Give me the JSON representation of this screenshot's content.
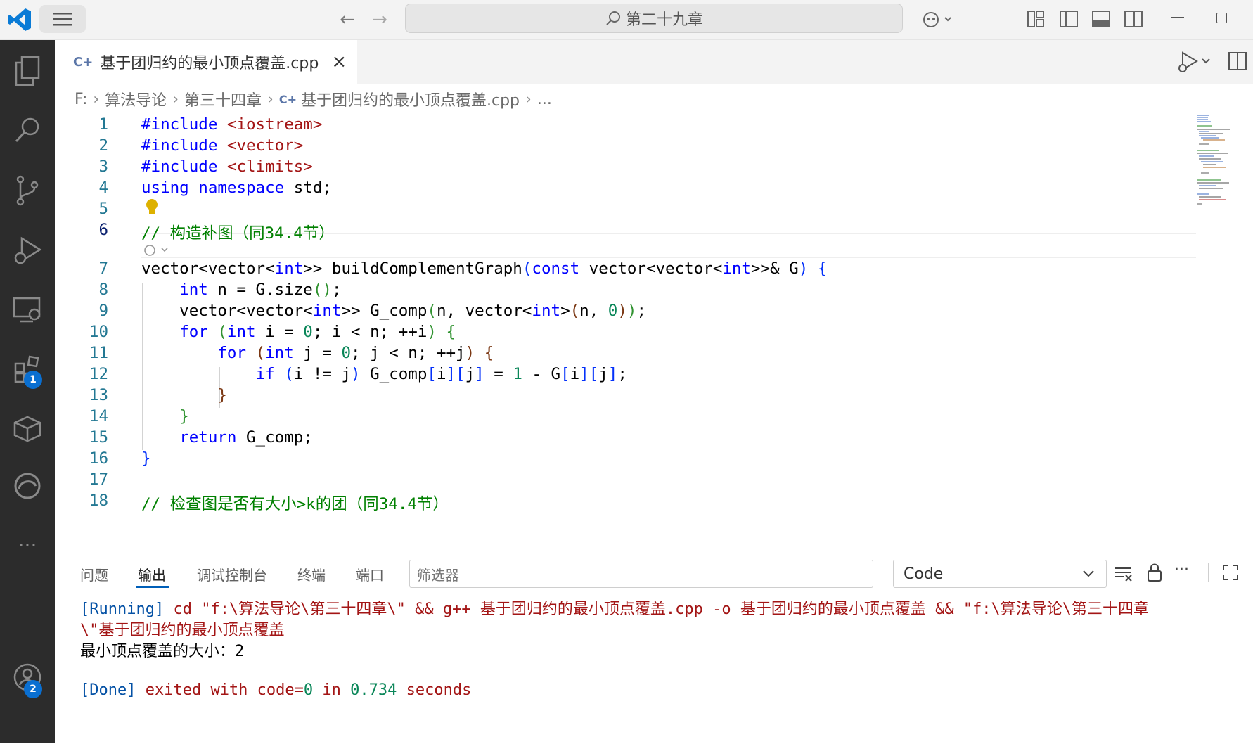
{
  "titlebar": {
    "search_text": "第二十九章"
  },
  "activity_bar": {
    "extensions_badge": "1",
    "accounts_badge": "2"
  },
  "tab": {
    "filename": "基于团归约的最小顶点覆盖.cpp",
    "close": "×"
  },
  "breadcrumb": {
    "items": [
      "F:",
      "算法导论",
      "第三十四章",
      "基于团归约的最小顶点覆盖.cpp",
      "..."
    ]
  },
  "editor": {
    "line_numbers": [
      "1",
      "2",
      "3",
      "4",
      "5",
      "6",
      "7",
      "8",
      "9",
      "10",
      "11",
      "12",
      "13",
      "14",
      "15",
      "16",
      "17",
      "18"
    ],
    "lines": {
      "l1": "#include <iostream>",
      "l2": "#include <vector>",
      "l3": "#include <climits>",
      "l4": "using namespace std;",
      "l6": "// 构造补图（同34.4节）",
      "l7": "vector<vector<int>> buildComplementGraph(const vector<vector<int>>& G) {",
      "l8": "int n = G.size();",
      "l9": "vector<vector<int>> G_comp(n, vector<int>(n, 0));",
      "l10": "for (int i = 0; i < n; ++i) {",
      "l11": "for (int j = 0; j < n; ++j) {",
      "l12": "if (i != j) G_comp[i][j] = 1 - G[i][j];",
      "l13": "}",
      "l14": "}",
      "l15": "return G_comp;",
      "l16": "}",
      "l18": "// 检查图是否有大小>k的团（同34.4节）"
    }
  },
  "panel": {
    "tabs": [
      "问题",
      "输出",
      "调试控制台",
      "终端",
      "端口"
    ],
    "active_tab": "输出",
    "filter_placeholder": "筛选器",
    "channel": "Code",
    "output": {
      "running_tag": "[Running]",
      "cmd_line1": " cd \"f:\\算法导论\\第三十四章\\\" && g++ 基于团归约的最小顶点覆盖.cpp -o 基于团归约的最小顶点覆盖 && \"f:\\算法导论\\第三十四章",
      "cmd_line2": "\\\"基于团归约的最小顶点覆盖",
      "result": "最小顶点覆盖的大小：2",
      "done_tag": "[Done]",
      "done_text": " exited with code=",
      "done_code": "0",
      "done_in": " in ",
      "done_time": "0.734",
      "done_seconds": " seconds"
    }
  }
}
